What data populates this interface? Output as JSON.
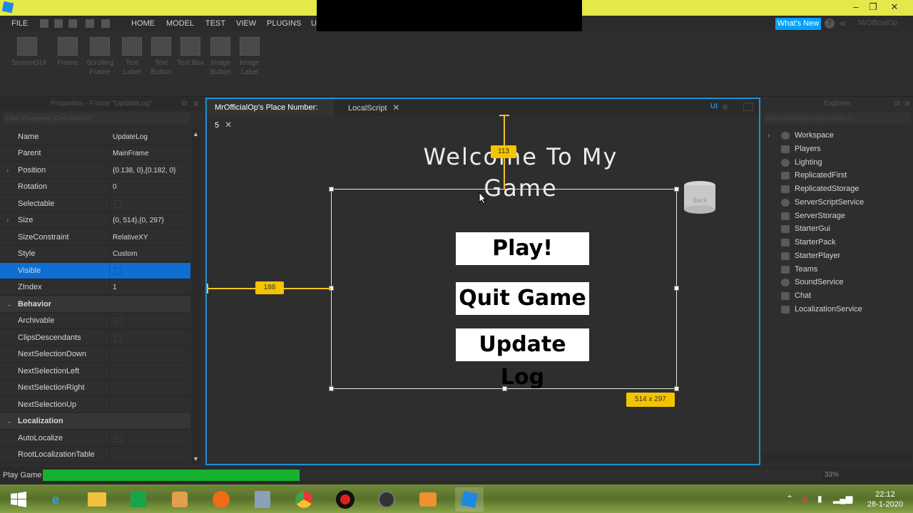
{
  "menubar": {
    "file": "FILE",
    "tabs": [
      "HOME",
      "MODEL",
      "TEST",
      "VIEW",
      "PLUGINS",
      "U"
    ],
    "whats_new": "What's New",
    "user": "MrOfficialOp"
  },
  "ribbon": {
    "tools": [
      "ScreenGUI",
      "Frame",
      "Scrolling Frame",
      "Text Label",
      "Text Button",
      "Text Box",
      "Image Button",
      "Image Label"
    ]
  },
  "properties": {
    "title": "Properties - Frame \"UpdateLog\"",
    "filter_placeholder": "Filter Properties (Ctrl+Shift+P)",
    "rows": [
      {
        "name": "Name",
        "value": "UpdateLog"
      },
      {
        "name": "Parent",
        "value": "MainFrame"
      },
      {
        "name": "Position",
        "value": "{0.138, 0},{0.182, 0}"
      },
      {
        "name": "Rotation",
        "value": "0"
      },
      {
        "name": "Selectable",
        "value": ""
      },
      {
        "name": "Size",
        "value": "{0, 514},{0, 297}"
      },
      {
        "name": "SizeConstraint",
        "value": "RelativeXY"
      },
      {
        "name": "Style",
        "value": "Custom"
      },
      {
        "name": "Visible",
        "value": ""
      },
      {
        "name": "ZIndex",
        "value": "1"
      },
      {
        "name": "Behavior",
        "value": ""
      },
      {
        "name": "Archivable",
        "value": ""
      },
      {
        "name": "ClipsDescendants",
        "value": ""
      },
      {
        "name": "NextSelectionDown",
        "value": ""
      },
      {
        "name": "NextSelectionLeft",
        "value": ""
      },
      {
        "name": "NextSelectionRight",
        "value": ""
      },
      {
        "name": "NextSelectionUp",
        "value": ""
      },
      {
        "name": "Localization",
        "value": ""
      },
      {
        "name": "AutoLocalize",
        "value": ""
      },
      {
        "name": "RootLocalizationTable",
        "value": ""
      }
    ]
  },
  "viewport": {
    "tabs": [
      "MrOfficialOp's Place Number: 5",
      "LocalScript"
    ],
    "ui_toggle": "UI",
    "welcome": "Welcome To My Game",
    "buttons": [
      "Play!",
      "Quit Game",
      "Update Log"
    ],
    "top_offset_badge": "113",
    "left_offset_badge": "188",
    "size_badge": "514 x 297",
    "part_label": "Back"
  },
  "explorer": {
    "title": "Explorer",
    "filter_placeholder": "Filter workspace (Ctrl+Shift+X)",
    "items": [
      "Workspace",
      "Players",
      "Lighting",
      "ReplicatedFirst",
      "ReplicatedStorage",
      "ServerScriptService",
      "ServerStorage",
      "StarterGui",
      "StarterPack",
      "StarterPlayer",
      "Teams",
      "SoundService",
      "Chat",
      "LocalizationService"
    ]
  },
  "status": {
    "label": "Play Game",
    "progress_percent": 33,
    "progress_text": "33%"
  },
  "taskbar": {
    "time": "22:12",
    "date": "28-1-2020"
  },
  "colors": {
    "title_bar": "#e5e84a",
    "accent": "#00a2ff",
    "selection": "#0e6ed2",
    "guide": "#f5c400",
    "progress": "#16b12e"
  }
}
